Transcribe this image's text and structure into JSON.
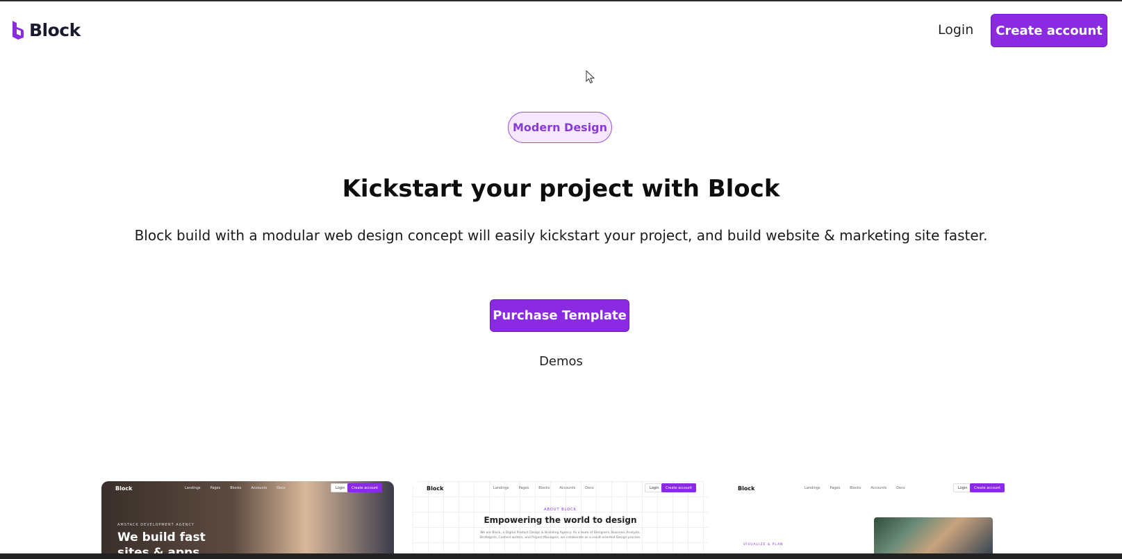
{
  "header": {
    "logo_text": "Block",
    "login_label": "Login",
    "create_account_label": "Create account"
  },
  "hero": {
    "badge": "Modern Design",
    "title": "Kickstart your project with Block",
    "subtitle": "Block build with a modular web design concept will easily kickstart your project, and build website & marketing site faster.",
    "purchase_label": "Purchase Template",
    "demos_label": "Demos"
  },
  "previews": [
    {
      "logo": "Block",
      "menu": [
        "Landings",
        "Pages",
        "Blocks",
        "Accounts",
        "Docs"
      ],
      "login": "Login",
      "create": "Create account",
      "kicker": "AMSTACK DEVELOPMENT AGENCY",
      "title": "We build fast sites & apps"
    },
    {
      "logo": "Block",
      "menu": [
        "Landings",
        "Pages",
        "Blocks",
        "Accounts",
        "Docs"
      ],
      "login": "Login",
      "create": "Create account",
      "kicker": "ABOUT BLOCK",
      "title": "Empowering the world to design",
      "text": "We are Block, a Digital Product Design & Branding Agency. As a team of Designers, Business Analysts, Strategists, Content writers, and Project Managers, we collaborate as a result-oriented Design process."
    },
    {
      "logo": "Block",
      "menu": [
        "Landings",
        "Pages",
        "Blocks",
        "Accounts",
        "Docs"
      ],
      "login": "Login",
      "create": "Create account",
      "kicker": "VISUALIZE & PLAN"
    }
  ],
  "colors": {
    "accent": "#8a2be2",
    "badge_bg": "#f6e8ff",
    "badge_text": "#8a3ad6"
  },
  "icons": {
    "logo": "block-logo-icon",
    "cursor": "mouse-cursor-icon"
  }
}
